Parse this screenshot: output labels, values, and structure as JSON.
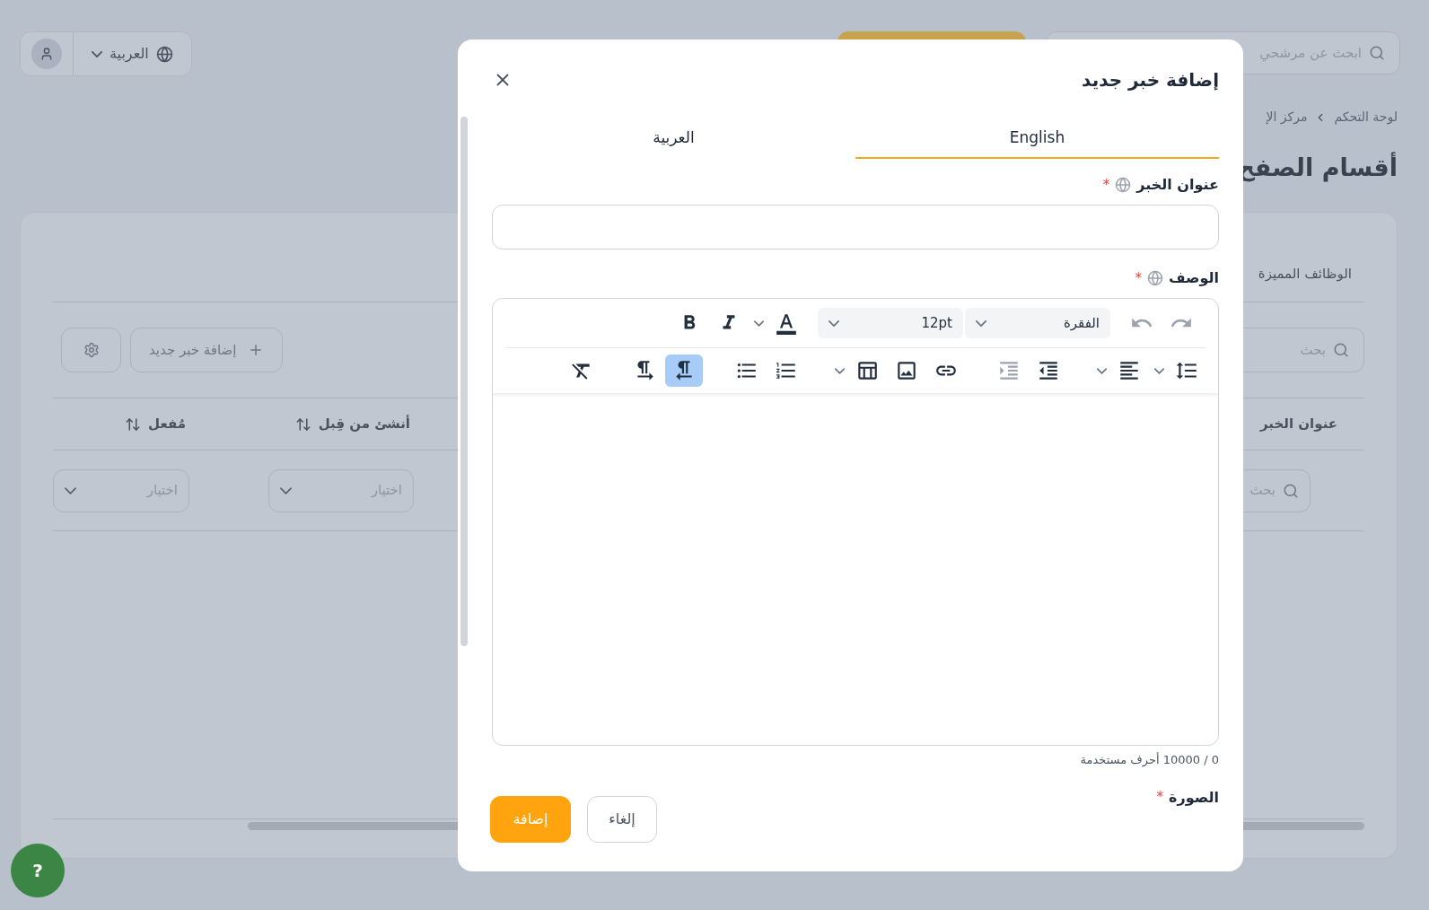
{
  "topbar": {
    "language": "العربية",
    "search": {
      "placeholder": "ابحث عن مرشحي"
    }
  },
  "breadcrumbs": [
    "لوحة التحكم",
    "مركز الإ"
  ],
  "page_title": "أقسام الصفح",
  "panel": {
    "tab": "الوظائف المميزة",
    "search": {
      "placeholder": "بحث"
    },
    "add_button": "إضافة خبر جديد",
    "table": {
      "columns": [
        {
          "label": "عنوان الخبر",
          "sortable": false
        },
        {
          "label": "أنشئ من قِبل",
          "sortable": true
        },
        {
          "label": "مُفعل",
          "sortable": true
        }
      ],
      "filters": [
        {
          "kind": "search",
          "placeholder": "بحث"
        },
        {
          "kind": "select",
          "placeholder": "اختيار"
        },
        {
          "kind": "select",
          "placeholder": "اختيار"
        }
      ]
    }
  },
  "help_button": "?",
  "dialog": {
    "title": "إضافة خبر جديد",
    "tabs": [
      {
        "label": "English",
        "selected": true
      },
      {
        "label": "العربية",
        "selected": false
      }
    ],
    "title_field": {
      "label": "عنوان الخبر",
      "required_mark": "*"
    },
    "description_field": {
      "label": "الوصف",
      "required_mark": "*"
    },
    "editor": {
      "rows": [
        {
          "groups": [
            {
              "tools": [
                {
                  "kind": "redo",
                  "dropdown": false,
                  "active": false,
                  "disabled": true
                },
                {
                  "kind": "undo",
                  "dropdown": false,
                  "active": false,
                  "disabled": true
                }
              ]
            },
            {
              "tools": [
                {
                  "kind": "select",
                  "value": "الفقرة",
                  "dropdown": true,
                  "active": false,
                  "disabled": false
                },
                {
                  "kind": "select",
                  "value": "12pt",
                  "dropdown": true,
                  "active": false,
                  "disabled": false
                }
              ]
            },
            {
              "tools": [
                {
                  "kind": "text-color",
                  "dropdown": true,
                  "active": false,
                  "disabled": false
                },
                {
                  "kind": "italic",
                  "dropdown": false,
                  "active": false,
                  "disabled": false
                },
                {
                  "kind": "bold",
                  "dropdown": false,
                  "active": false,
                  "disabled": false
                }
              ]
            }
          ]
        },
        {
          "groups": [
            {
              "tools": [
                {
                  "kind": "line-height",
                  "dropdown": true,
                  "active": false,
                  "disabled": false
                },
                {
                  "kind": "align",
                  "dropdown": true,
                  "active": false,
                  "disabled": false
                }
              ]
            },
            {
              "tools": [
                {
                  "kind": "outdent",
                  "dropdown": false,
                  "active": false,
                  "disabled": false
                },
                {
                  "kind": "indent",
                  "dropdown": false,
                  "active": false,
                  "disabled": true
                }
              ]
            },
            {
              "tools": [
                {
                  "kind": "link",
                  "dropdown": false,
                  "active": false,
                  "disabled": false
                },
                {
                  "kind": "image",
                  "dropdown": false,
                  "active": false,
                  "disabled": false
                },
                {
                  "kind": "table",
                  "dropdown": true,
                  "active": false,
                  "disabled": false
                }
              ]
            },
            {
              "tools": [
                {
                  "kind": "numbered-list",
                  "dropdown": false,
                  "active": false,
                  "disabled": false
                },
                {
                  "kind": "bullet-list",
                  "dropdown": false,
                  "active": false,
                  "disabled": false
                }
              ]
            },
            {
              "tools": [
                {
                  "kind": "rtl",
                  "dropdown": false,
                  "active": true,
                  "disabled": false
                },
                {
                  "kind": "ltr",
                  "dropdown": false,
                  "active": false,
                  "disabled": false
                }
              ]
            },
            {
              "tools": [
                {
                  "kind": "clear-format",
                  "dropdown": false,
                  "active": false,
                  "disabled": false
                }
              ]
            }
          ]
        }
      ]
    },
    "counter": "0 / 10000 أحرف مستخدمة",
    "image_field": {
      "label": "الصورة",
      "required_mark": "*"
    },
    "buttons": [
      {
        "label": "إلغاء",
        "kind": "secondary"
      },
      {
        "label": "إضافة",
        "kind": "primary"
      }
    ]
  }
}
